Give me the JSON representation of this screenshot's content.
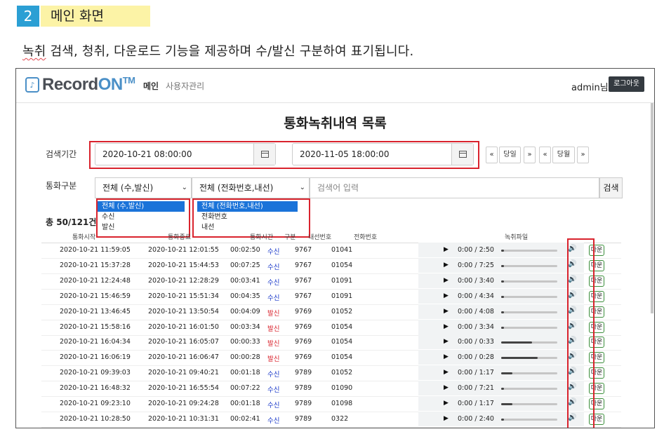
{
  "section": {
    "number": "2",
    "title": "메인 화면"
  },
  "description": {
    "underlined": "녹취",
    "rest": " 검색, 청취, 다운로드 기능을 제공하며 수/발신 구분하여 표기됩니다."
  },
  "app": {
    "logo_prefix": "Record",
    "logo_suffix": "ON",
    "logo_tm": "TM",
    "nav": {
      "main": "메인",
      "users": "사용자관리"
    },
    "user": "admin님",
    "logout": "로그아웃",
    "title": "통화녹취내역 목록",
    "search_period_label": "검색기간",
    "date_from": "2020-10-21 08:00:00",
    "date_to": "2020-11-05 18:00:00",
    "pager": {
      "prev": "«",
      "today": "당일",
      "next": "»",
      "prev2": "«",
      "month": "당월",
      "next2": "»"
    },
    "call_type_label": "통화구분",
    "select_direction": "전체 (수,발신)",
    "select_number_type": "전체 (전화번호,내선)",
    "search_placeholder": "검색어 입력",
    "search_button": "검색",
    "dropdown_direction": [
      "전체 (수,발신)",
      "수신",
      "발신"
    ],
    "dropdown_number_type": [
      "전체 (전화번호,내선)",
      "전화번호",
      "내선"
    ],
    "total": "총 50/121건",
    "columns": {
      "start": "통화시작",
      "end": "통화종료",
      "duration": "통화시간",
      "direction": "구분",
      "extension": "내선번호",
      "phone": "전화번호",
      "file": "녹취파일"
    },
    "download_label": "다운",
    "rows": [
      {
        "start": "2020-10-21 11:59:05",
        "end": "2020-10-21 12:01:55",
        "duration": "00:02:50",
        "direction": "수신",
        "dir_type": "recv",
        "extension": "9767",
        "phone": "01041",
        "audio_time": "0:00 / 2:50",
        "level": 0.05
      },
      {
        "start": "2020-10-21 15:37:28",
        "end": "2020-10-21 15:44:53",
        "duration": "00:07:25",
        "direction": "수신",
        "dir_type": "recv",
        "extension": "9767",
        "phone": "01054",
        "audio_time": "0:00 / 7:25",
        "level": 0.05
      },
      {
        "start": "2020-10-21 12:24:48",
        "end": "2020-10-21 12:28:29",
        "duration": "00:03:41",
        "direction": "수신",
        "dir_type": "recv",
        "extension": "9767",
        "phone": "01091",
        "audio_time": "0:00 / 3:40",
        "level": 0.05
      },
      {
        "start": "2020-10-21 15:46:59",
        "end": "2020-10-21 15:51:34",
        "duration": "00:04:35",
        "direction": "수신",
        "dir_type": "recv",
        "extension": "9767",
        "phone": "01091",
        "audio_time": "0:00 / 4:34",
        "level": 0.05
      },
      {
        "start": "2020-10-21 13:46:45",
        "end": "2020-10-21 13:50:54",
        "duration": "00:04:09",
        "direction": "발신",
        "dir_type": "send",
        "extension": "9769",
        "phone": "01052",
        "audio_time": "0:00 / 4:08",
        "level": 0.05
      },
      {
        "start": "2020-10-21 15:58:16",
        "end": "2020-10-21 16:01:50",
        "duration": "00:03:34",
        "direction": "발신",
        "dir_type": "send",
        "extension": "9769",
        "phone": "01054",
        "audio_time": "0:00 / 3:34",
        "level": 0.05
      },
      {
        "start": "2020-10-21 16:04:34",
        "end": "2020-10-21 16:05:07",
        "duration": "00:00:33",
        "direction": "발신",
        "dir_type": "send",
        "extension": "9769",
        "phone": "01054",
        "audio_time": "0:00 / 0:33",
        "level": 0.55
      },
      {
        "start": "2020-10-21 16:06:19",
        "end": "2020-10-21 16:06:47",
        "duration": "00:00:28",
        "direction": "발신",
        "dir_type": "send",
        "extension": "9769",
        "phone": "01054",
        "audio_time": "0:00 / 0:28",
        "level": 0.65
      },
      {
        "start": "2020-10-21 09:39:03",
        "end": "2020-10-21 09:40:21",
        "duration": "00:01:18",
        "direction": "수신",
        "dir_type": "recv",
        "extension": "9789",
        "phone": "01052",
        "audio_time": "0:00 / 1:17",
        "level": 0.2
      },
      {
        "start": "2020-10-21 16:48:32",
        "end": "2020-10-21 16:55:54",
        "duration": "00:07:22",
        "direction": "수신",
        "dir_type": "recv",
        "extension": "9789",
        "phone": "01090",
        "audio_time": "0:00 / 7:21",
        "level": 0.05
      },
      {
        "start": "2020-10-21 09:23:10",
        "end": "2020-10-21 09:24:28",
        "duration": "00:01:18",
        "direction": "수신",
        "dir_type": "recv",
        "extension": "9789",
        "phone": "01098",
        "audio_time": "0:00 / 1:17",
        "level": 0.2
      },
      {
        "start": "2020-10-21 10:28:50",
        "end": "2020-10-21 10:31:31",
        "duration": "00:02:41",
        "direction": "수신",
        "dir_type": "recv",
        "extension": "9789",
        "phone": "0322",
        "audio_time": "0:00 / 2:40",
        "level": 0.05
      }
    ]
  }
}
